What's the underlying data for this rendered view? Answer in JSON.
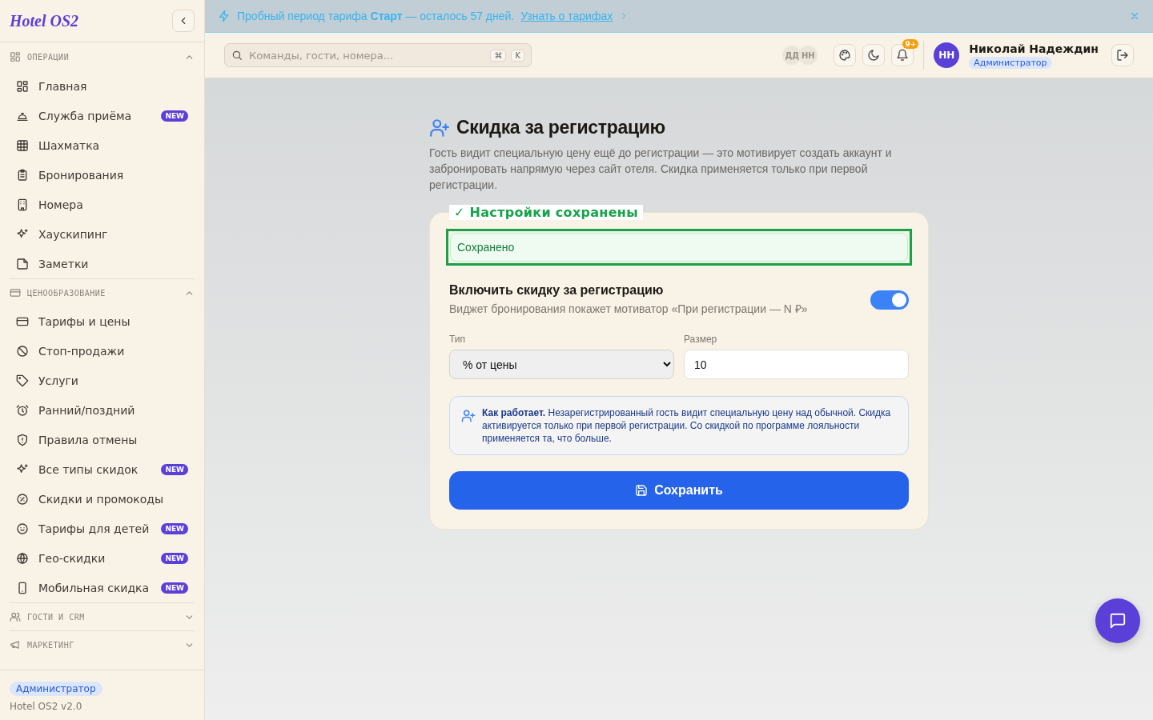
{
  "sidebar": {
    "logo": "Hotel OS2",
    "sections": [
      {
        "label": "ОПЕРАЦИИ",
        "expanded": true,
        "items": [
          {
            "label": "Главная"
          },
          {
            "label": "Служба приёма",
            "badge": "NEW"
          },
          {
            "label": "Шахматка"
          },
          {
            "label": "Бронирования"
          },
          {
            "label": "Номера"
          },
          {
            "label": "Хаускипинг"
          },
          {
            "label": "Заметки"
          }
        ]
      },
      {
        "label": "ЦЕНООБРАЗОВАНИЕ",
        "expanded": true,
        "items": [
          {
            "label": "Тарифы и цены"
          },
          {
            "label": "Стоп-продажи"
          },
          {
            "label": "Услуги"
          },
          {
            "label": "Ранний/поздний"
          },
          {
            "label": "Правила отмены"
          },
          {
            "label": "Все типы скидок",
            "badge": "NEW"
          },
          {
            "label": "Скидки и промокоды"
          },
          {
            "label": "Тарифы для детей",
            "badge": "NEW"
          },
          {
            "label": "Гео-скидки",
            "badge": "NEW"
          },
          {
            "label": "Мобильная скидка",
            "badge": "NEW"
          }
        ]
      },
      {
        "label": "ГОСТИ И CRM",
        "expanded": false
      },
      {
        "label": "МАРКЕТИНГ",
        "expanded": false
      }
    ],
    "role": "Администратор",
    "version": "Hotel OS2 v2.0"
  },
  "banner": {
    "text": "Пробный период тарифа **Старт** — осталось 57 дней.",
    "link": "Узнать о тарифах"
  },
  "topbar": {
    "search": {
      "placeholder": "Команды, гости, номера...",
      "keys": [
        "⌘",
        "K"
      ]
    },
    "presence": [
      "ДД",
      "НН"
    ],
    "notifications": "9+",
    "user": {
      "initials": "НН",
      "name": "Николай Надеждин",
      "role": "Администратор"
    }
  },
  "page": {
    "title": "Скидка за регистрацию",
    "description": "Гость видит специальную цену ещё до регистрации — это мотивирует создать аккаунт и забронировать напрямую через сайт отеля. Скидка применяется только при первой регистрации.",
    "toast": "✓ Настройки сохранены",
    "status_field": {
      "value": "Сохранено"
    },
    "toggle": {
      "label": "Включить скидку за регистрацию",
      "hint": "Виджет бронирования покажет мотиватор «При регистрации — N ₽»",
      "on": true
    },
    "type_field": {
      "label": "Тип",
      "value": "% от цены"
    },
    "size_field": {
      "label": "Размер",
      "value": "10"
    },
    "info": "**Как работает.** Незарегистрированный гость видит специальную цену над обычной. Скидка активируется только при первой регистрации. Со скидкой по программе лояльности применяется та, что больше.",
    "save_button": "Сохранить"
  }
}
